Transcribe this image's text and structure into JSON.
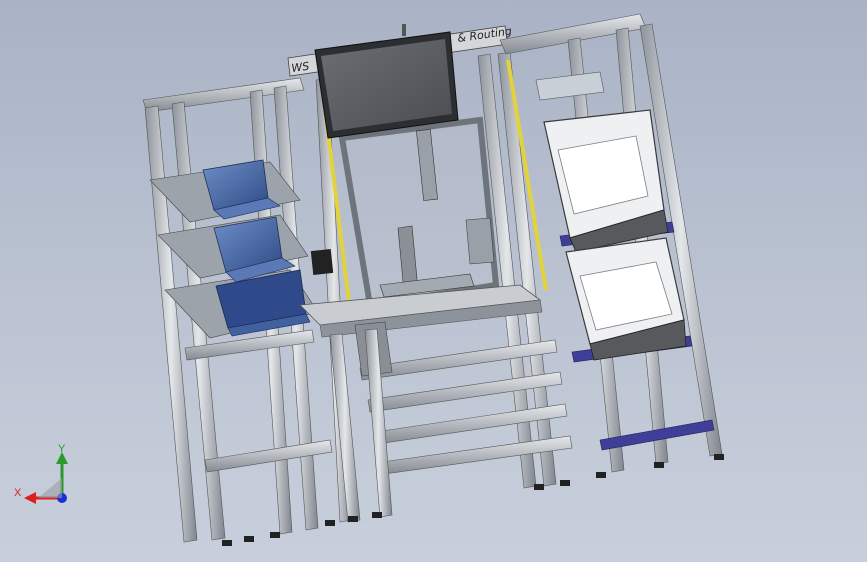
{
  "signboard": {
    "left_text": "WS",
    "right_text": "& Routing"
  },
  "triad": {
    "x_label": "X",
    "y_label": "Y",
    "x_color": "#d9201b",
    "y_color": "#2a9a2a",
    "z_color": "#1a2fd6"
  },
  "colors": {
    "background": "#b3bccc",
    "frame": "#c7ccd2",
    "bin_blue": "#3b5c9c",
    "crate_purple": "#3f3f9a",
    "caution_yellow": "#e2d23b"
  }
}
